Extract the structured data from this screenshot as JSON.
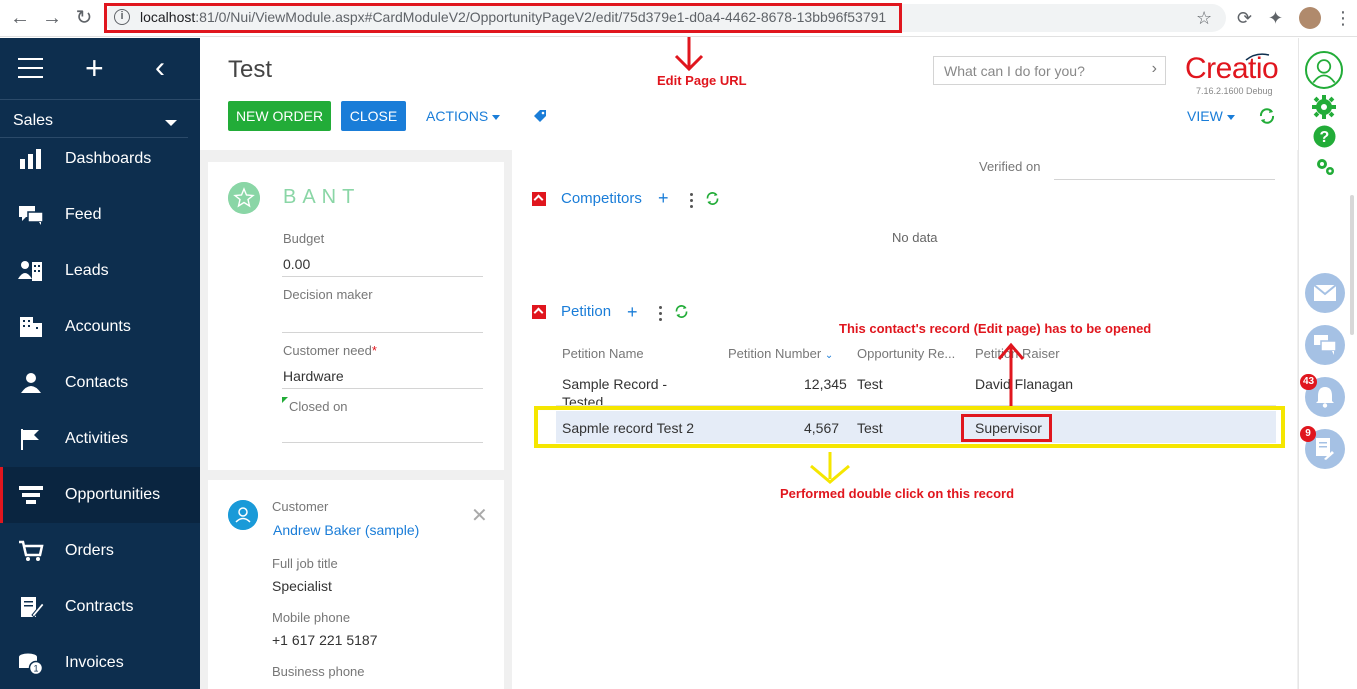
{
  "browser": {
    "url_host": "localhost",
    "url_path": ":81/0/Nui/ViewModule.aspx#CardModuleV2/OpportunityPageV2/edit/75d379e1-d0a4-4462-8678-13bb96f53791"
  },
  "sidebar": {
    "workplace": "Sales",
    "items": [
      {
        "label": "Dashboards"
      },
      {
        "label": "Feed"
      },
      {
        "label": "Leads"
      },
      {
        "label": "Accounts"
      },
      {
        "label": "Contacts"
      },
      {
        "label": "Activities"
      },
      {
        "label": "Opportunities"
      },
      {
        "label": "Orders"
      },
      {
        "label": "Contracts"
      },
      {
        "label": "Invoices"
      }
    ]
  },
  "header": {
    "title": "Test",
    "new_order": "NEW ORDER",
    "close": "CLOSE",
    "actions": "ACTIONS",
    "view": "VIEW",
    "search_placeholder": "What can I do for you?",
    "logo": "Creatio",
    "version": "7.16.2.1600 Debug"
  },
  "bant": {
    "title": "BANT",
    "budget_label": "Budget",
    "budget_value": "0.00",
    "decision_maker_label": "Decision maker",
    "customer_need_label": "Customer need",
    "customer_need_value": "Hardware",
    "closed_on_label": "Closed on"
  },
  "customer": {
    "label": "Customer",
    "name": "Andrew Baker (sample)",
    "job_title_label": "Full job title",
    "job_title_value": "Specialist",
    "mobile_label": "Mobile phone",
    "mobile_value": "+1 617 221 5187",
    "business_phone_label": "Business phone"
  },
  "details": {
    "verified_on": "Verified on",
    "competitors_title": "Competitors",
    "no_data": "No data",
    "petition_title": "Petition",
    "columns": [
      "Petition Name",
      "Petition Number",
      "Opportunity Re...",
      "Petition Raiser"
    ],
    "rows": [
      {
        "name": "Sample Record -",
        "name2": "Tested",
        "number": "12,345",
        "opportunity": "Test",
        "raiser": "David Flanagan"
      },
      {
        "name": "Sapmle record Test 2",
        "number": "4,567",
        "opportunity": "Test",
        "raiser": "Supervisor"
      }
    ]
  },
  "annotations": {
    "edit_url": "Edit Page URL",
    "contact_record": "This contact's record (Edit page) has to be opened",
    "double_click": "Performed double click on this record"
  },
  "right_bar": {
    "notifications_count": "43",
    "tasks_count": "9"
  },
  "colors": {
    "nav_bg": "#0d2e4e",
    "accent_red": "#e0161e",
    "accent_green": "#22ac38",
    "accent_blue": "#1a7dd8",
    "highlight_yellow": "#f5e600"
  }
}
